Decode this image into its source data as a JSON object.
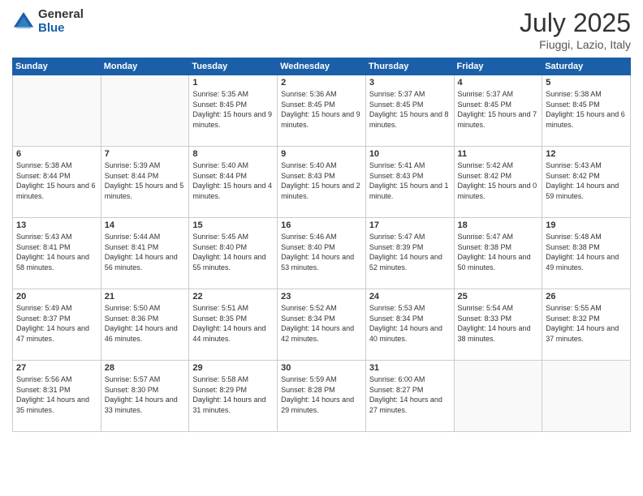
{
  "logo": {
    "general": "General",
    "blue": "Blue"
  },
  "title": {
    "month_year": "July 2025",
    "location": "Fiuggi, Lazio, Italy"
  },
  "days_of_week": [
    "Sunday",
    "Monday",
    "Tuesday",
    "Wednesday",
    "Thursday",
    "Friday",
    "Saturday"
  ],
  "weeks": [
    [
      {
        "day": "",
        "empty": true
      },
      {
        "day": "",
        "empty": true
      },
      {
        "day": "1",
        "sunrise": "Sunrise: 5:35 AM",
        "sunset": "Sunset: 8:45 PM",
        "daylight": "Daylight: 15 hours and 9 minutes."
      },
      {
        "day": "2",
        "sunrise": "Sunrise: 5:36 AM",
        "sunset": "Sunset: 8:45 PM",
        "daylight": "Daylight: 15 hours and 9 minutes."
      },
      {
        "day": "3",
        "sunrise": "Sunrise: 5:37 AM",
        "sunset": "Sunset: 8:45 PM",
        "daylight": "Daylight: 15 hours and 8 minutes."
      },
      {
        "day": "4",
        "sunrise": "Sunrise: 5:37 AM",
        "sunset": "Sunset: 8:45 PM",
        "daylight": "Daylight: 15 hours and 7 minutes."
      },
      {
        "day": "5",
        "sunrise": "Sunrise: 5:38 AM",
        "sunset": "Sunset: 8:45 PM",
        "daylight": "Daylight: 15 hours and 6 minutes."
      }
    ],
    [
      {
        "day": "6",
        "sunrise": "Sunrise: 5:38 AM",
        "sunset": "Sunset: 8:44 PM",
        "daylight": "Daylight: 15 hours and 6 minutes."
      },
      {
        "day": "7",
        "sunrise": "Sunrise: 5:39 AM",
        "sunset": "Sunset: 8:44 PM",
        "daylight": "Daylight: 15 hours and 5 minutes."
      },
      {
        "day": "8",
        "sunrise": "Sunrise: 5:40 AM",
        "sunset": "Sunset: 8:44 PM",
        "daylight": "Daylight: 15 hours and 4 minutes."
      },
      {
        "day": "9",
        "sunrise": "Sunrise: 5:40 AM",
        "sunset": "Sunset: 8:43 PM",
        "daylight": "Daylight: 15 hours and 2 minutes."
      },
      {
        "day": "10",
        "sunrise": "Sunrise: 5:41 AM",
        "sunset": "Sunset: 8:43 PM",
        "daylight": "Daylight: 15 hours and 1 minute."
      },
      {
        "day": "11",
        "sunrise": "Sunrise: 5:42 AM",
        "sunset": "Sunset: 8:42 PM",
        "daylight": "Daylight: 15 hours and 0 minutes."
      },
      {
        "day": "12",
        "sunrise": "Sunrise: 5:43 AM",
        "sunset": "Sunset: 8:42 PM",
        "daylight": "Daylight: 14 hours and 59 minutes."
      }
    ],
    [
      {
        "day": "13",
        "sunrise": "Sunrise: 5:43 AM",
        "sunset": "Sunset: 8:41 PM",
        "daylight": "Daylight: 14 hours and 58 minutes."
      },
      {
        "day": "14",
        "sunrise": "Sunrise: 5:44 AM",
        "sunset": "Sunset: 8:41 PM",
        "daylight": "Daylight: 14 hours and 56 minutes."
      },
      {
        "day": "15",
        "sunrise": "Sunrise: 5:45 AM",
        "sunset": "Sunset: 8:40 PM",
        "daylight": "Daylight: 14 hours and 55 minutes."
      },
      {
        "day": "16",
        "sunrise": "Sunrise: 5:46 AM",
        "sunset": "Sunset: 8:40 PM",
        "daylight": "Daylight: 14 hours and 53 minutes."
      },
      {
        "day": "17",
        "sunrise": "Sunrise: 5:47 AM",
        "sunset": "Sunset: 8:39 PM",
        "daylight": "Daylight: 14 hours and 52 minutes."
      },
      {
        "day": "18",
        "sunrise": "Sunrise: 5:47 AM",
        "sunset": "Sunset: 8:38 PM",
        "daylight": "Daylight: 14 hours and 50 minutes."
      },
      {
        "day": "19",
        "sunrise": "Sunrise: 5:48 AM",
        "sunset": "Sunset: 8:38 PM",
        "daylight": "Daylight: 14 hours and 49 minutes."
      }
    ],
    [
      {
        "day": "20",
        "sunrise": "Sunrise: 5:49 AM",
        "sunset": "Sunset: 8:37 PM",
        "daylight": "Daylight: 14 hours and 47 minutes."
      },
      {
        "day": "21",
        "sunrise": "Sunrise: 5:50 AM",
        "sunset": "Sunset: 8:36 PM",
        "daylight": "Daylight: 14 hours and 46 minutes."
      },
      {
        "day": "22",
        "sunrise": "Sunrise: 5:51 AM",
        "sunset": "Sunset: 8:35 PM",
        "daylight": "Daylight: 14 hours and 44 minutes."
      },
      {
        "day": "23",
        "sunrise": "Sunrise: 5:52 AM",
        "sunset": "Sunset: 8:34 PM",
        "daylight": "Daylight: 14 hours and 42 minutes."
      },
      {
        "day": "24",
        "sunrise": "Sunrise: 5:53 AM",
        "sunset": "Sunset: 8:34 PM",
        "daylight": "Daylight: 14 hours and 40 minutes."
      },
      {
        "day": "25",
        "sunrise": "Sunrise: 5:54 AM",
        "sunset": "Sunset: 8:33 PM",
        "daylight": "Daylight: 14 hours and 38 minutes."
      },
      {
        "day": "26",
        "sunrise": "Sunrise: 5:55 AM",
        "sunset": "Sunset: 8:32 PM",
        "daylight": "Daylight: 14 hours and 37 minutes."
      }
    ],
    [
      {
        "day": "27",
        "sunrise": "Sunrise: 5:56 AM",
        "sunset": "Sunset: 8:31 PM",
        "daylight": "Daylight: 14 hours and 35 minutes."
      },
      {
        "day": "28",
        "sunrise": "Sunrise: 5:57 AM",
        "sunset": "Sunset: 8:30 PM",
        "daylight": "Daylight: 14 hours and 33 minutes."
      },
      {
        "day": "29",
        "sunrise": "Sunrise: 5:58 AM",
        "sunset": "Sunset: 8:29 PM",
        "daylight": "Daylight: 14 hours and 31 minutes."
      },
      {
        "day": "30",
        "sunrise": "Sunrise: 5:59 AM",
        "sunset": "Sunset: 8:28 PM",
        "daylight": "Daylight: 14 hours and 29 minutes."
      },
      {
        "day": "31",
        "sunrise": "Sunrise: 6:00 AM",
        "sunset": "Sunset: 8:27 PM",
        "daylight": "Daylight: 14 hours and 27 minutes."
      },
      {
        "day": "",
        "empty": true
      },
      {
        "day": "",
        "empty": true
      }
    ]
  ]
}
